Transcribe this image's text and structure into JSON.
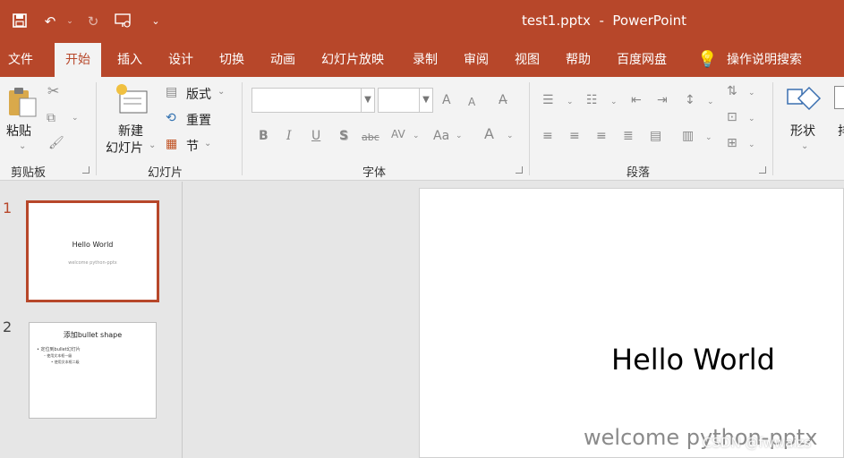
{
  "titlebar": {
    "doc_title": "test1.pptx  -  PowerPoint",
    "top_right_partial": "",
    "colors": {
      "accent": "#b7472a"
    }
  },
  "tabs": [
    "文件",
    "开始",
    "插入",
    "设计",
    "切换",
    "动画",
    "幻灯片放映",
    "录制",
    "审阅",
    "视图",
    "帮助",
    "百度网盘"
  ],
  "active_tab": "开始",
  "tell_me": "操作说明搜索",
  "ribbon": {
    "clipboard": {
      "paste": "粘贴",
      "label": "剪贴板"
    },
    "slides": {
      "new_slide_l1": "新建",
      "new_slide_l2": "幻灯片",
      "layout": "版式",
      "reset": "重置",
      "section": "节",
      "label": "幻灯片"
    },
    "font": {
      "label": "字体"
    },
    "paragraph": {
      "label": "段落"
    },
    "drawing": {
      "shapes": "形状",
      "partial": "排"
    }
  },
  "thumbnails": [
    {
      "number": "1",
      "title": "Hello World",
      "subtitle": "welcome python-pptx"
    },
    {
      "number": "2",
      "title": "添加bullet shape",
      "bullets": [
        "定位到bullet幻灯片",
        "使用文本框一级",
        "使用文本框二级"
      ]
    }
  ],
  "slide": {
    "title": "Hello World",
    "subtitle": "welcome python-pptx"
  },
  "watermark": "CSDN @fwwaizs"
}
